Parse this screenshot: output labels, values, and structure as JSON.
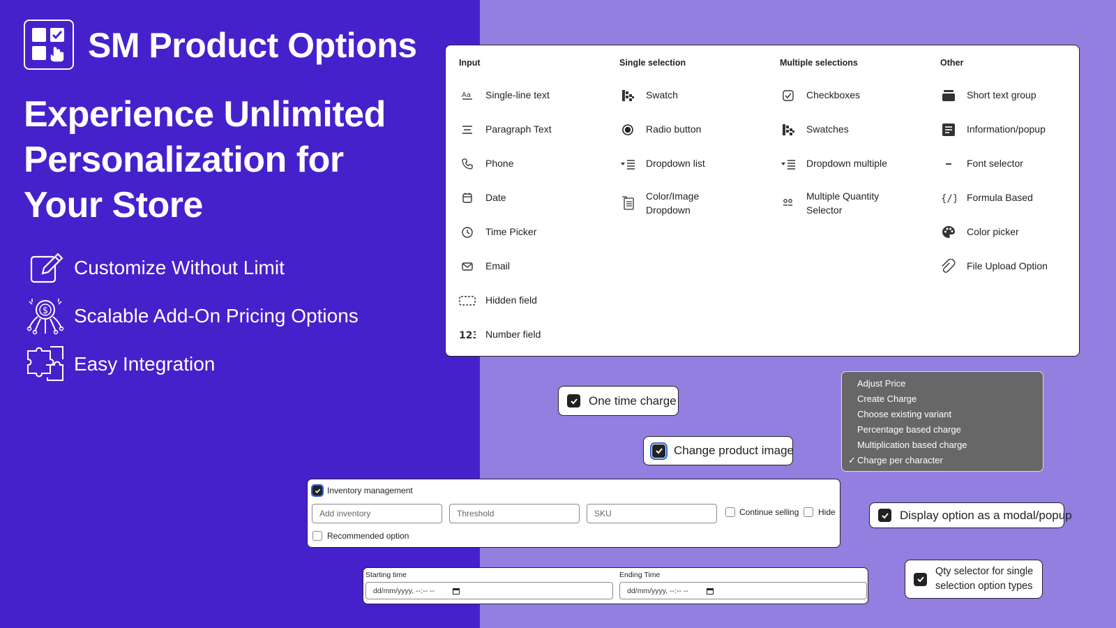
{
  "brand": {
    "title": "SM Product Options",
    "headline": [
      "Experience Unlimited",
      "Personalization for",
      "Your Store"
    ],
    "features": [
      {
        "label": "Customize Without Limit",
        "icon": "edit-icon"
      },
      {
        "label": "Scalable Add-On Pricing Options",
        "icon": "pricing-octopus-icon"
      },
      {
        "label": "Easy Integration",
        "icon": "puzzle-icon"
      }
    ]
  },
  "colors": {
    "left_bg": "#4521cc",
    "right_bg": "#927fe0",
    "menu_bg": "#676767",
    "focus": "#2a63d6"
  },
  "option_groups": [
    {
      "heading": "Input",
      "items": [
        {
          "label": "Single-line text",
          "icon": "text-aa-icon"
        },
        {
          "label": "Paragraph Text",
          "icon": "paragraph-icon"
        },
        {
          "label": "Phone",
          "icon": "phone-icon"
        },
        {
          "label": "Date",
          "icon": "calendar-icon"
        },
        {
          "label": "Time Picker",
          "icon": "clock-icon"
        },
        {
          "label": "Email",
          "icon": "mail-icon"
        },
        {
          "label": "Hidden field",
          "icon": "hidden-field-icon"
        },
        {
          "label": "Number field",
          "icon": "number-123-icon"
        }
      ]
    },
    {
      "heading": "Single selection",
      "items": [
        {
          "label": "Swatch",
          "icon": "swatch-icon"
        },
        {
          "label": "Radio button",
          "icon": "radio-icon"
        },
        {
          "label": "Dropdown list",
          "icon": "dropdown-list-icon"
        },
        {
          "label": "Color/Image Dropdown",
          "icon": "color-image-dropdown-icon"
        }
      ]
    },
    {
      "heading": "Multiple selections",
      "items": [
        {
          "label": "Checkboxes",
          "icon": "checkbox-icon"
        },
        {
          "label": "Swatches",
          "icon": "swatch-icon"
        },
        {
          "label": "Dropdown multiple",
          "icon": "dropdown-list-icon"
        },
        {
          "label": "Multiple Quantity Selector",
          "icon": "quantity-selector-icon"
        }
      ]
    },
    {
      "heading": "Other",
      "items": [
        {
          "label": "Short text group",
          "icon": "text-group-icon"
        },
        {
          "label": "Information/popup",
          "icon": "info-popup-icon"
        },
        {
          "label": "Font selector",
          "icon": "minus-icon"
        },
        {
          "label": "Formula Based",
          "icon": "formula-icon"
        },
        {
          "label": "Color picker",
          "icon": "palette-icon"
        },
        {
          "label": "File Upload Option",
          "icon": "paperclip-icon"
        }
      ]
    }
  ],
  "chips": {
    "one_time_charge": "One time charge",
    "change_product_image": "Change product image",
    "display_modal": "Display option as a modal/popup",
    "qty_selector": [
      "Qty selector for single",
      "selection option types"
    ]
  },
  "price_menu": {
    "items": [
      "Adjust Price",
      "Create Charge",
      "Choose existing variant",
      "Percentage based charge",
      "Multiplication based charge",
      "Charge per character"
    ],
    "selected": "Charge per character",
    "check_mark": "✓"
  },
  "inventory": {
    "label": "Inventory management",
    "add_placeholder": "Add inventory",
    "threshold_placeholder": "Threshold",
    "sku_placeholder": "SKU",
    "continue_selling": "Continue selling",
    "hide": "Hide",
    "recommended": "Recommended option"
  },
  "time": {
    "start_label": "Starting time",
    "end_label": "Ending Time",
    "start_value": "dd/mm/yyyy, --:-- --",
    "end_value": "dd/mm/yyyy, --:-- --"
  }
}
